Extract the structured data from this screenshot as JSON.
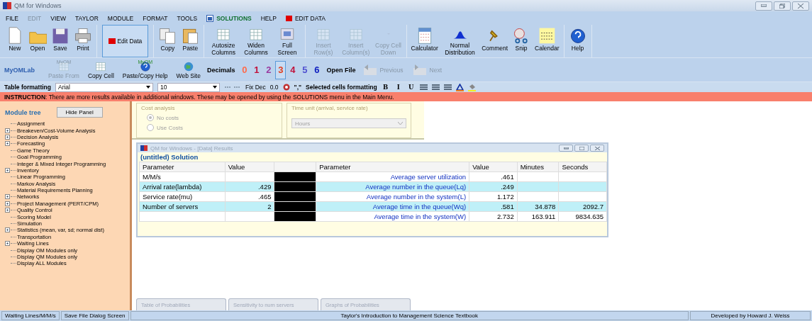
{
  "window": {
    "title": "QM for Windows"
  },
  "menu": [
    {
      "label": "FILE",
      "disabled": false,
      "kind": "plain"
    },
    {
      "label": "EDIT",
      "disabled": true,
      "kind": "plain"
    },
    {
      "label": "VIEW",
      "disabled": false,
      "kind": "plain"
    },
    {
      "label": "TAYLOR",
      "disabled": false,
      "kind": "plain"
    },
    {
      "label": "MODULE",
      "disabled": false,
      "kind": "plain"
    },
    {
      "label": "FORMAT",
      "disabled": false,
      "kind": "plain"
    },
    {
      "label": "TOOLS",
      "disabled": false,
      "kind": "plain"
    },
    {
      "label": "SOLUTIONS",
      "disabled": false,
      "kind": "solutions"
    },
    {
      "label": "HELP",
      "disabled": false,
      "kind": "plain"
    },
    {
      "label": "EDIT DATA",
      "disabled": false,
      "kind": "editdata"
    }
  ],
  "toolbar": [
    {
      "label": "New",
      "disabled": false
    },
    {
      "label": "Open",
      "disabled": false
    },
    {
      "label": "Save",
      "disabled": false
    },
    {
      "label": "Print",
      "disabled": false
    },
    {
      "label": "Edit Data",
      "disabled": false
    },
    {
      "label": "Copy",
      "disabled": false
    },
    {
      "label": "Paste",
      "disabled": false
    },
    {
      "label": "Autosize Columns",
      "disabled": false
    },
    {
      "label": "Widen Columns",
      "disabled": false
    },
    {
      "label": "Full Screen",
      "disabled": false
    },
    {
      "label": "Insert Row(s)",
      "disabled": true
    },
    {
      "label": "Insert Column(s)",
      "disabled": true
    },
    {
      "label": "Copy Cell Down",
      "disabled": true
    },
    {
      "label": "Calculator",
      "disabled": false
    },
    {
      "label": "Normal Distribution",
      "disabled": false
    },
    {
      "label": "Comment",
      "disabled": false
    },
    {
      "label": "Snip",
      "disabled": false
    },
    {
      "label": "Calendar",
      "disabled": false
    },
    {
      "label": "Help",
      "disabled": false
    }
  ],
  "toolbar2": {
    "myomlab": "MyOMLab",
    "items": [
      {
        "label": "Paste From",
        "badge": "MyOM",
        "disabled": true
      },
      {
        "label": "Copy Cell",
        "disabled": false
      },
      {
        "label": "Paste/Copy Help",
        "badge": "MyOM",
        "disabled": false
      },
      {
        "label": "Web Site",
        "disabled": false
      }
    ],
    "decimals_label": "Decimals",
    "decimals": [
      {
        "label": "0",
        "color": "#ff6a4a",
        "selected": false
      },
      {
        "label": "1",
        "color": "#c0103a",
        "selected": false
      },
      {
        "label": "2",
        "color": "#9a3aa0",
        "selected": false
      },
      {
        "label": "3",
        "color": "#e04020",
        "selected": true
      },
      {
        "label": "4",
        "color": "#c0103a",
        "selected": false
      },
      {
        "label": "5",
        "color": "#5050d0",
        "selected": false
      },
      {
        "label": "6",
        "color": "#1020c0",
        "selected": false
      }
    ],
    "open_file": "Open File",
    "nav": [
      {
        "label": "Previous",
        "disabled": true
      },
      {
        "label": "Next",
        "disabled": true
      }
    ]
  },
  "format_bar": {
    "label": "Table formatting",
    "font": "Arial",
    "size": "10",
    "fix_dec": "Fix Dec",
    "zero": "0.0",
    "comma": "\",\"",
    "selected_label": "Selected cells formatting",
    "style_buttons": [
      "B",
      "I",
      "U"
    ]
  },
  "instruction": {
    "lead": "INSTRUCTION",
    "text": ": There are more results available in additional windows. These may be opened by using the SOLUTIONS menu in the Main Menu."
  },
  "module_tree": {
    "title": "Module tree",
    "hide_button": "Hide Panel",
    "items": [
      {
        "label": "Assignment",
        "expandable": false
      },
      {
        "label": "Breakeven/Cost-Volume Analysis",
        "expandable": true
      },
      {
        "label": "Decision Analysis",
        "expandable": true
      },
      {
        "label": "Forecasting",
        "expandable": true
      },
      {
        "label": "Game Theory",
        "expandable": false
      },
      {
        "label": "Goal Programming",
        "expandable": false
      },
      {
        "label": "Integer & Mixed Integer Programming",
        "expandable": false
      },
      {
        "label": "Inventory",
        "expandable": true
      },
      {
        "label": "Linear Programming",
        "expandable": false
      },
      {
        "label": "Markov Analysis",
        "expandable": false
      },
      {
        "label": "Material Requirements Planning",
        "expandable": false
      },
      {
        "label": "Networks",
        "expandable": true
      },
      {
        "label": "Project Management (PERT/CPM)",
        "expandable": true
      },
      {
        "label": "Quality Control",
        "expandable": true
      },
      {
        "label": "Scoring Model",
        "expandable": false
      },
      {
        "label": "Simulation",
        "expandable": false
      },
      {
        "label": "Statistics (mean, var, sd; normal dist)",
        "expandable": true
      },
      {
        "label": "Transportation",
        "expandable": false
      },
      {
        "label": "Waiting Lines",
        "expandable": true
      },
      {
        "label": "Display OM Modules only",
        "expandable": false
      },
      {
        "label": "Display QM Modules only",
        "expandable": false
      },
      {
        "label": "Display ALL Modules",
        "expandable": false
      }
    ]
  },
  "cost_analysis": {
    "title": "Cost analysis",
    "options": [
      {
        "label": "No costs",
        "selected": true
      },
      {
        "label": "Use Costs",
        "selected": false
      }
    ]
  },
  "time_unit": {
    "title": "Time unit (arrival, service rate)",
    "value": "Hours"
  },
  "results_window": {
    "title": "QM for Windows - [Data] Results",
    "heading": "(untitled) Solution",
    "columns": [
      "Parameter",
      "Value",
      "",
      "Parameter",
      "Value",
      "Minutes",
      "Seconds"
    ],
    "rows": [
      {
        "highlighted": false,
        "cells": [
          "M/M/s",
          "",
          "",
          "Average server utilization",
          ".461",
          "",
          ""
        ]
      },
      {
        "highlighted": true,
        "cells": [
          "Arrival rate(lambda)",
          ".429",
          "",
          "Average number in the queue(Lq)",
          ".249",
          "",
          ""
        ]
      },
      {
        "highlighted": false,
        "cells": [
          "Service rate(mu)",
          ".465",
          "",
          "Average number in the system(L)",
          "1.172",
          "",
          ""
        ]
      },
      {
        "highlighted": true,
        "cells": [
          "Number of servers",
          "2",
          "",
          "Average time in the queue(Wq)",
          ".581",
          "34.878",
          "2092.7"
        ]
      },
      {
        "highlighted": false,
        "cells": [
          "",
          "",
          "",
          "Average time in the system(W)",
          "2.732",
          "163.911",
          "9834.635"
        ]
      }
    ]
  },
  "bottom_tabs": [
    {
      "label": "Table of Probabilities",
      "disabled": true
    },
    {
      "label": "Sensitivity to num servers",
      "disabled": true
    },
    {
      "label": "Graphs of Probabilities",
      "disabled": true
    }
  ],
  "status_bar": [
    "Waiting Lines/M/M/s",
    "Save File Dialog Screen",
    "Taylor's Introduction to Management Science Textbook",
    "Developed by Howard J. Weiss"
  ]
}
